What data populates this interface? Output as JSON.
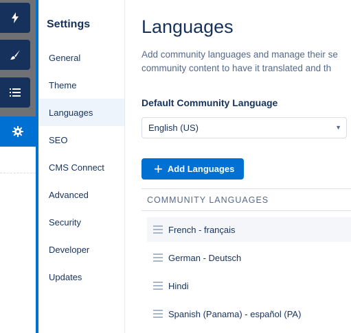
{
  "rail": {
    "buttons": [
      {
        "icon": "lightning-icon"
      },
      {
        "icon": "paintbrush-icon"
      },
      {
        "icon": "list-icon"
      },
      {
        "icon": "gear-icon"
      }
    ]
  },
  "settings": {
    "title": "Settings",
    "items": [
      {
        "label": "General"
      },
      {
        "label": "Theme"
      },
      {
        "label": "Languages",
        "selected": true
      },
      {
        "label": "SEO"
      },
      {
        "label": "CMS Connect"
      },
      {
        "label": "Advanced"
      },
      {
        "label": "Security"
      },
      {
        "label": "Developer"
      },
      {
        "label": "Updates"
      }
    ]
  },
  "main": {
    "title": "Languages",
    "description_line1": "Add community languages and manage their se",
    "description_line2": "community content to have it translated and th",
    "default_label": "Default Community Language",
    "default_value": "English (US)",
    "add_button": "Add Languages",
    "list_header": "COMMUNITY LANGUAGES",
    "languages": [
      {
        "name": "French - français"
      },
      {
        "name": "German - Deutsch"
      },
      {
        "name": "Hindi"
      },
      {
        "name": "Spanish (Panama) - español (PA)"
      }
    ]
  },
  "colors": {
    "accent": "#0070d2",
    "rail_dark": "#16325c",
    "selected_bg": "#eef4fb"
  }
}
